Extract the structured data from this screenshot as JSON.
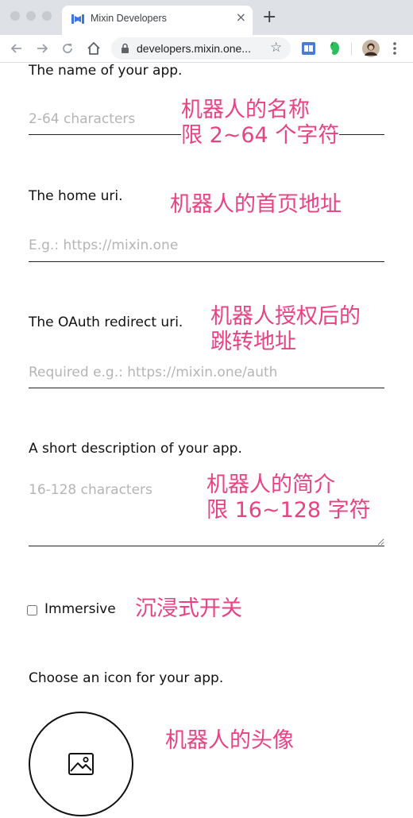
{
  "browser": {
    "tab_title": "Mixin Developers",
    "url": "developers.mixin.one..."
  },
  "form": {
    "name_label": "The name of your app.",
    "name_placeholder": "2-64 characters",
    "home_label": "The home uri.",
    "home_placeholder": "E.g.: https://mixin.one",
    "redirect_label": "The OAuth redirect uri.",
    "redirect_placeholder": "Required e.g.: https://mixin.one/auth",
    "desc_label": "A short description of your app.",
    "desc_placeholder": "16-128 characters",
    "immersive_label": "Immersive",
    "immersive_checked": false,
    "icon_label": "Choose an icon for your app."
  },
  "annotations": {
    "name_line1": "机器人的名称",
    "name_line2": "限 2~64 个字符",
    "home": "机器人的首页地址",
    "redirect_line1": "机器人授权后的",
    "redirect_line2": "跳转地址",
    "desc_line1": "机器人的简介",
    "desc_line2": "限 16~128 字符",
    "immersive": "沉浸式开关",
    "icon": "机器人的头像"
  },
  "colors": {
    "annotation": "#e84283",
    "favicon": "#3d75e3"
  },
  "icons": [
    "favicon-icon",
    "close-icon",
    "plus-icon",
    "back-arrow-icon",
    "forward-arrow-icon",
    "reload-icon",
    "home-icon",
    "lock-icon",
    "star-icon",
    "extension-reader-icon",
    "evernote-icon",
    "avatar",
    "kebab-menu-icon",
    "image-placeholder-icon"
  ]
}
